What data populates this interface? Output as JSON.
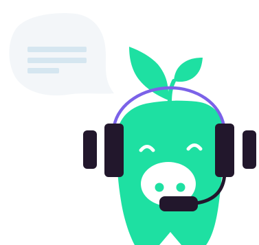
{
  "illustration": {
    "subject": "pig-mascot-with-headset",
    "speech_bubble": {
      "text_lines": 3
    },
    "colors": {
      "mint": "#1ee0a2",
      "headset_dark": "#22172c",
      "headband_purple": "#7b62e8",
      "bubble_fill": "#f3f6f9",
      "bubble_lines": "#d5e6f0",
      "background": "#ffffff"
    }
  }
}
